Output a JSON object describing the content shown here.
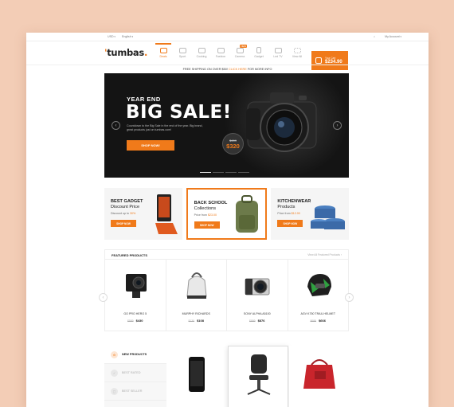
{
  "topbar": {
    "currency": "USD",
    "language": "English",
    "my_account": "My Account"
  },
  "header": {
    "logo": "tumbas",
    "nav": [
      {
        "label": "Deals",
        "badge": ""
      },
      {
        "label": "Sport",
        "badge": ""
      },
      {
        "label": "Cooking",
        "badge": ""
      },
      {
        "label": "Fashion",
        "badge": ""
      },
      {
        "label": "Camera",
        "badge": "NEW"
      },
      {
        "label": "Gadget",
        "badge": ""
      },
      {
        "label": "Led TV",
        "badge": ""
      },
      {
        "label": "View All",
        "badge": ""
      }
    ],
    "cart": {
      "label": "Your Cart",
      "amount": "$234.90"
    }
  },
  "shipping": {
    "pre": "FREE SHIPPING ON OVER $50!",
    "link": "CLICK HERE",
    "post": "FOR MORE INFO"
  },
  "hero": {
    "kicker": "YEAR END",
    "headline": "BIG SALE!",
    "description": "Countdown to the Big Sale in the end of the year. Big brand, great products just on tumbas.com!",
    "button": "SHOP NOW!",
    "old_price": "$459",
    "new_price": "$320"
  },
  "promos": [
    {
      "title_1": "BEST GADGET",
      "title_2": "Discount Price",
      "sub_pre": "Discount up to",
      "sub_hl": "30%",
      "button": "SHOP NOW"
    },
    {
      "title_1": "BACK SCHOOL",
      "title_2": "Collections",
      "sub_pre": "Price from",
      "sub_hl": "$23.00",
      "button": "SHOP NOW"
    },
    {
      "title_1": "KITCHENWEAR",
      "title_2": "Products",
      "sub_pre": "Price from",
      "sub_hl": "$12.00",
      "button": "SHOP NOW"
    }
  ],
  "featured": {
    "title": "FEATURED PRODUCTS",
    "view_all": "View All Featured Products",
    "products": [
      {
        "name": "GO PRO HERO 5",
        "old": "$599",
        "price": "$430"
      },
      {
        "name": "MURPHY RICHARDS",
        "old": "$130",
        "price": "$108"
      },
      {
        "name": "SONY ALPHA A5100",
        "old": "$999",
        "price": "$876"
      },
      {
        "name": "AGV K750 TRAIL HELMET",
        "old": "$699",
        "price": "$666"
      }
    ]
  },
  "lower_tabs": [
    {
      "label": "NEW PRODUCTS"
    },
    {
      "label": "BEST RATED"
    },
    {
      "label": "BEST SELLER"
    }
  ],
  "colors": {
    "accent": "#f07a1a",
    "dark": "#141414",
    "background": "#f3cdb6"
  }
}
